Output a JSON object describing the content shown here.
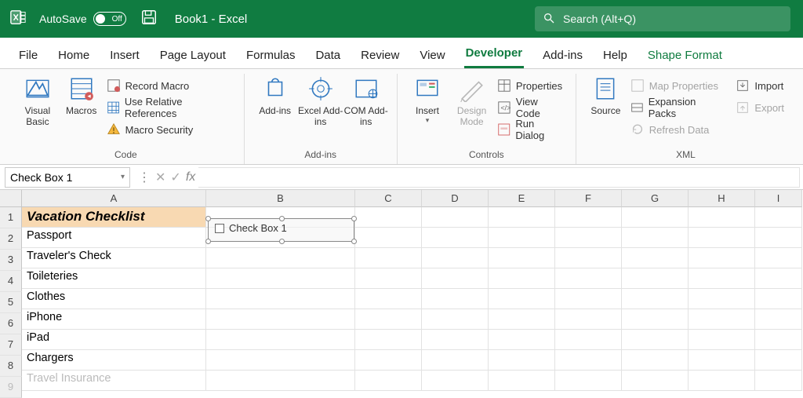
{
  "title": {
    "autosave": "AutoSave",
    "autosave_state": "Off",
    "doc": "Book1  -  Excel"
  },
  "search": {
    "placeholder": "Search (Alt+Q)"
  },
  "tabs": [
    "File",
    "Home",
    "Insert",
    "Page Layout",
    "Formulas",
    "Data",
    "Review",
    "View",
    "Developer",
    "Add-ins",
    "Help",
    "Shape Format"
  ],
  "ribbon": {
    "code": {
      "label": "Code",
      "visual_basic": "Visual Basic",
      "macros": "Macros",
      "record": "Record Macro",
      "use_rel": "Use Relative References",
      "macro_sec": "Macro Security"
    },
    "addins": {
      "label": "Add-ins",
      "addins": "Add-ins",
      "excel": "Excel Add-ins",
      "com": "COM Add-ins"
    },
    "controls": {
      "label": "Controls",
      "insert": "Insert",
      "design": "Design Mode",
      "props": "Properties",
      "view_code": "View Code",
      "run_dialog": "Run Dialog"
    },
    "xml": {
      "label": "XML",
      "source": "Source",
      "map_props": "Map Properties",
      "exp_packs": "Expansion Packs",
      "refresh": "Refresh Data",
      "import": "Import",
      "export": "Export"
    }
  },
  "namebox": "Check Box 1",
  "columns": [
    "A",
    "B",
    "C",
    "D",
    "E",
    "F",
    "G",
    "H",
    "I"
  ],
  "rows": [
    "1",
    "2",
    "3",
    "4",
    "5",
    "6",
    "7",
    "8",
    "9"
  ],
  "cells": {
    "a1": "Vacation Checklist",
    "a2": "Passport",
    "a3": "Traveler's Check",
    "a4": "Toileteries",
    "a5": "Clothes",
    "a6": "iPhone",
    "a7": "iPad",
    "a8": "Chargers",
    "a9": "Travel Insurance"
  },
  "checkbox": {
    "label": "Check Box 1"
  }
}
